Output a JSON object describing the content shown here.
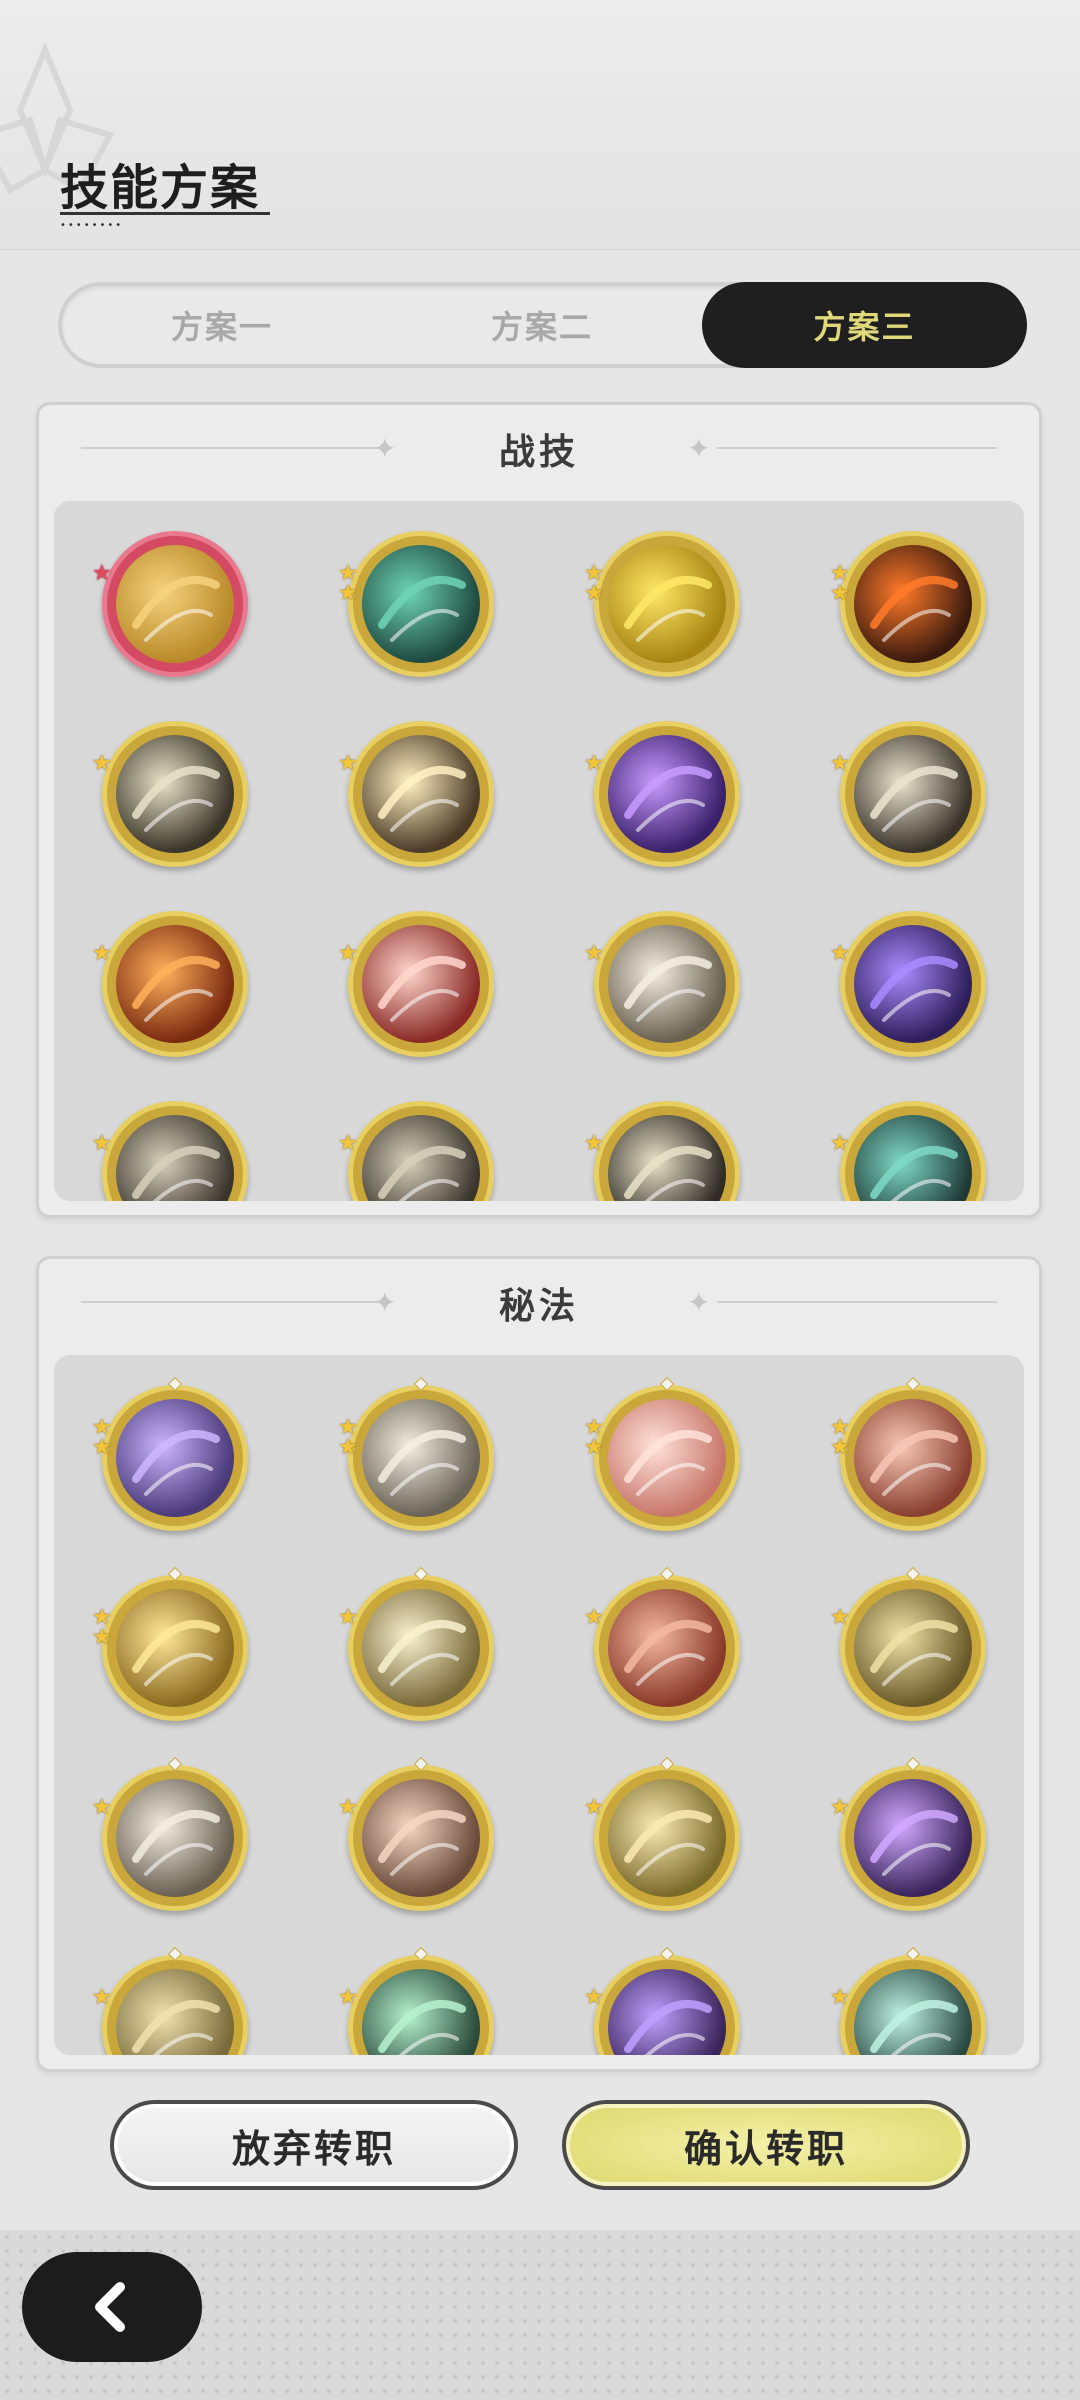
{
  "header": {
    "title": "技能方案"
  },
  "tabs": [
    {
      "label": "方案一",
      "active": false
    },
    {
      "label": "方案二",
      "active": false
    },
    {
      "label": "方案三",
      "active": true
    }
  ],
  "sections": {
    "combat": {
      "title": "战技"
    },
    "arcane": {
      "title": "秘法"
    }
  },
  "combat_skills": [
    {
      "icon": "golden-swirl-slash-icon",
      "stars": 1,
      "star_color": "red",
      "bg": "#b98a2a",
      "accent": "#f6d27c"
    },
    {
      "icon": "teal-slash-icon",
      "stars": 2,
      "bg": "#1f4a40",
      "accent": "#6ed4b6"
    },
    {
      "icon": "golden-shield-up-icon",
      "stars": 2,
      "bg": "#a88512",
      "accent": "#ffe766"
    },
    {
      "icon": "fire-slash-icon",
      "stars": 2,
      "bg": "#3a1a0e",
      "accent": "#ff7a2a"
    },
    {
      "icon": "wind-slash-icon",
      "stars": 1,
      "bg": "#3a3528",
      "accent": "#e9e1c8"
    },
    {
      "icon": "burst-explosion-icon",
      "stars": 1,
      "bg": "#4a3a26",
      "accent": "#fff1c2"
    },
    {
      "icon": "purple-heart-star-icon",
      "stars": 1,
      "bg": "#3a1f6a",
      "accent": "#c79bff"
    },
    {
      "icon": "spike-claw-icon",
      "stars": 1,
      "bg": "#3a332a",
      "accent": "#ece3cf"
    },
    {
      "icon": "fire-rune-icon",
      "stars": 1,
      "bg": "#7a2a10",
      "accent": "#ffb05a"
    },
    {
      "icon": "sword-raise-icon",
      "stars": 1,
      "bg": "#8a2a26",
      "accent": "#ffd6cc"
    },
    {
      "icon": "charging-beast-icon",
      "stars": 1,
      "bg": "#6a6050",
      "accent": "#f5efe2"
    },
    {
      "icon": "purple-shadow-icon",
      "stars": 1,
      "bg": "#2e1e5a",
      "accent": "#a98cff"
    },
    {
      "icon": "dark-hand-icon",
      "stars": 1,
      "bg": "#3a352c",
      "accent": "#d8cfbb"
    },
    {
      "icon": "crescent-moon-icon",
      "stars": 1,
      "bg": "#3a352c",
      "accent": "#d8cfbb"
    },
    {
      "icon": "shadow-orb-icon",
      "stars": 1,
      "bg": "#2e2a24",
      "accent": "#e9e1c8"
    },
    {
      "icon": "green-web-icon",
      "stars": 1,
      "bg": "#1f3a36",
      "accent": "#7ed8c6"
    }
  ],
  "arcane_skills": [
    {
      "icon": "purple-orb-plus-icon",
      "stars": 2,
      "bg": "#4a3a7a",
      "accent": "#cbb6ff"
    },
    {
      "icon": "silver-sword-icon",
      "stars": 2,
      "bg": "#6a6356",
      "accent": "#f3eee2"
    },
    {
      "icon": "pink-sword-plus-icon",
      "stars": 2,
      "bg": "#c8776a",
      "accent": "#ffe2da"
    },
    {
      "icon": "red-shell-icon",
      "stars": 2,
      "bg": "#8a4030",
      "accent": "#f8c7b6"
    },
    {
      "icon": "golden-spirit-icon",
      "stars": 2,
      "bg": "#8a6a20",
      "accent": "#ffe79a"
    },
    {
      "icon": "eye-pyramid-icon",
      "stars": 1,
      "bg": "#7a6a3a",
      "accent": "#f9f1cf"
    },
    {
      "icon": "crimson-beast-icon",
      "stars": 1,
      "bg": "#8a3a2a",
      "accent": "#f3b7a0"
    },
    {
      "icon": "golden-guardians-icon",
      "stars": 1,
      "bg": "#6a5a2a",
      "accent": "#efe2a6"
    },
    {
      "icon": "holy-sword-icon",
      "stars": 1,
      "bg": "#6a6052",
      "accent": "#f3ede0"
    },
    {
      "icon": "heart-shield-icon",
      "stars": 1,
      "bg": "#6a4a3a",
      "accent": "#f5d6c2"
    },
    {
      "icon": "golden-vortex-icon",
      "stars": 1,
      "bg": "#7a6a2a",
      "accent": "#f9eab2"
    },
    {
      "icon": "purple-flame-icon",
      "stars": 1,
      "bg": "#3a245a",
      "accent": "#d0a8ff"
    },
    {
      "icon": "golden-armor-icon",
      "stars": 1,
      "bg": "#7a6a3a",
      "accent": "#efe2b0"
    },
    {
      "icon": "green-heal-icon",
      "stars": 1,
      "bg": "#2a4a3a",
      "accent": "#b6f2cf"
    },
    {
      "icon": "purple-book-icon",
      "stars": 1,
      "bg": "#3a245a",
      "accent": "#bfa0ff"
    },
    {
      "icon": "green-cross-icon",
      "stars": 1,
      "bg": "#2a4a44",
      "accent": "#bff2e2"
    }
  ],
  "buttons": {
    "abandon": "放弃转职",
    "confirm": "确认转职"
  }
}
